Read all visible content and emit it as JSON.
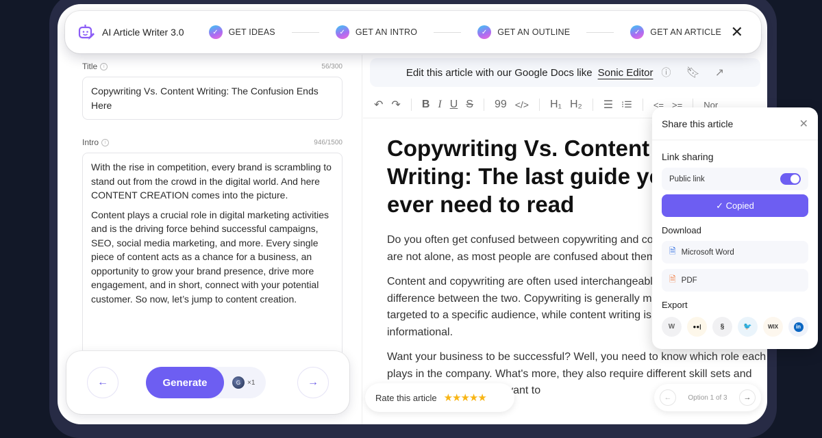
{
  "header": {
    "app_title": "AI Article Writer 3.0",
    "steps": [
      {
        "label": "GET IDEAS",
        "done": true
      },
      {
        "label": "GET AN INTRO",
        "done": true
      },
      {
        "label": "GET AN OUTLINE",
        "done": true
      },
      {
        "label": "GET AN ARTICLE",
        "done": true
      }
    ],
    "close_icon": "close-icon"
  },
  "left": {
    "title_label": "Title",
    "title_count": "56/300",
    "title_value": "Copywriting Vs. Content Writing: The Confusion Ends Here",
    "intro_label": "Intro",
    "intro_count": "946/1500",
    "intro_paragraphs": [
      "With the rise in competition, every brand is scrambling to stand out from the crowd in the digital world. And here CONTENT CREATION comes into the picture.",
      "Content plays a crucial role in digital marketing activities and is the driving force behind successful campaigns, SEO, social media marketing, and more. Every single piece of content acts as a chance for a business, an opportunity to grow your brand presence, drive more engagement, and in short, connect with your potential customer. So now, let’s jump to content creation."
    ],
    "generate_label": "Generate",
    "credit_count": "×1",
    "prev_icon": "←",
    "next_icon": "→"
  },
  "editor": {
    "banner_text": "Edit this article with our Google Docs like",
    "banner_link": "Sonic Editor",
    "toolbar": {
      "undo": "↶",
      "redo": "↷",
      "bold": "B",
      "italic": "I",
      "underline": "U",
      "strike": "S",
      "quote": "99",
      "code": "</>",
      "h1": "H₁",
      "h2": "H₂",
      "bullet_list": "☰",
      "ordered_list": "⁝☰",
      "outdent": "<=",
      "indent": ">=",
      "style_select": "Nor"
    },
    "article_title": "Copywriting Vs. Content Writing: The last guide you'll ever need to read",
    "paragraphs": [
      "Do you often get confused between copywriting and content writing? Well, you are not alone, as most people are confused about them.",
      "Content and copywriting are often used interchangeably, but there is a lot of difference between the two. Copywriting is generally more persuasive and targeted to a specific audience, while content writing is usually more informational.",
      "Want your business to be successful? Well, you need to know which role each plays in the company. What's more, they also require different skill sets and techniques. In case you want to"
    ],
    "rate_label": "Rate this article",
    "rating": 5,
    "rating_stars": "★★★★★",
    "option_label": "Option 1 of 3"
  },
  "share": {
    "title": "Share this article",
    "link_sharing": "Link sharing",
    "public_link": "Public link",
    "public_link_on": true,
    "copied_label": "✓ Copied",
    "download": "Download",
    "word": "Microsoft Word",
    "pdf": "PDF",
    "export": "Export",
    "export_targets": [
      {
        "name": "wordpress",
        "glyph": "W",
        "bg": "#f1f1f3",
        "color": "#666"
      },
      {
        "name": "medium",
        "glyph": "●●|",
        "bg": "#fdf7ea",
        "color": "#111"
      },
      {
        "name": "squarespace",
        "glyph": "§",
        "bg": "#f1f1f3",
        "color": "#333"
      },
      {
        "name": "twitter",
        "glyph": "🐦",
        "bg": "#eaf4fb",
        "color": "#1d9bf0"
      },
      {
        "name": "wix",
        "glyph": "WIX",
        "bg": "#fdf7ee",
        "color": "#333"
      },
      {
        "name": "linkedin",
        "glyph": "in",
        "bg": "#eef2fa",
        "color": "#0a66c2"
      }
    ]
  },
  "colors": {
    "accent": "#6d5ef2",
    "star": "#f8b515",
    "frame": "#272b45",
    "background": "#121828"
  }
}
